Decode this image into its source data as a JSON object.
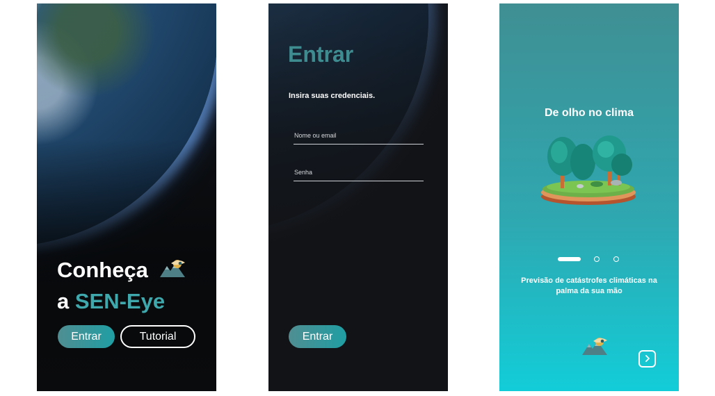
{
  "welcome": {
    "headline_line1": "Conheça",
    "headline_line2_prefix": "a ",
    "headline_brand": "SEN-Eye",
    "enter_button": "Entrar",
    "tutorial_button": "Tutorial"
  },
  "login": {
    "title": "Entrar",
    "subtitle": "Insira suas credenciais.",
    "user_placeholder": "Nome ou email",
    "password_placeholder": "Senha",
    "enter_button": "Entrar"
  },
  "onboarding": {
    "title": "De olho no clima",
    "illustration": "forest-island-illustration",
    "description": "Previsão de catástrofes climáticas na palma da sua mão",
    "pages_total": 3,
    "current_page": 1,
    "next_icon": "chevron-right-icon"
  },
  "colors": {
    "brand_teal": "#3ea8ad",
    "button_gradient_start": "#4f8e92",
    "button_gradient_end": "#1f9ea3",
    "onboarding_top": "#3f8f93",
    "onboarding_bottom": "#12cdd8"
  }
}
